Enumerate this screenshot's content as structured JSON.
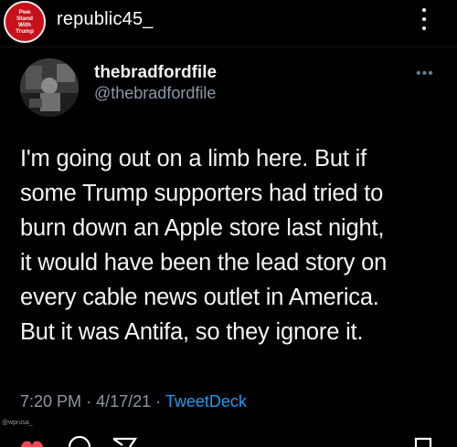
{
  "post": {
    "avatar_text": [
      "Pwe",
      "Stand",
      "With",
      "Trump"
    ],
    "username": "republic45_",
    "menu_icon": "more-vertical-icon"
  },
  "tweet": {
    "display_name": "thebradfordfile",
    "handle": "@thebradfordfile",
    "more_icon": "more-horizontal-icon",
    "text_lines": [
      "I'm going out on a limb here. But if",
      "some Trump supporters had tried to",
      "burn down an Apple store last night,",
      "it would have been the lead story on",
      "every cable news outlet in America.",
      "But it was Antifa, so they ignore it."
    ],
    "time": "7:20 PM",
    "date": "4/17/21",
    "source": "TweetDeck"
  },
  "watermark": "@wprusa_",
  "actions": [
    "heart-icon",
    "comment-icon",
    "share-icon",
    "bookmark-icon"
  ],
  "colors": {
    "background": "#000000",
    "avatar_red": "#c8101a",
    "handle_gray": "#8b98a5",
    "link_blue": "#1d9bf0"
  }
}
